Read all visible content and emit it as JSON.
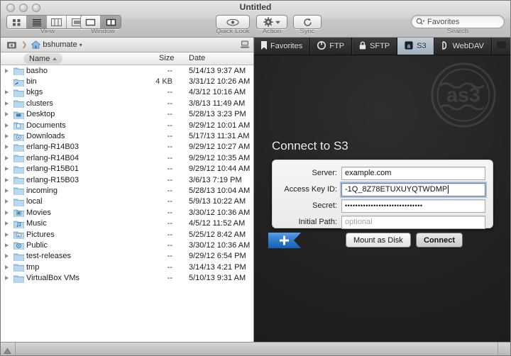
{
  "window": {
    "title": "Untitled",
    "traffic_lights": [
      "close",
      "minimize",
      "zoom"
    ]
  },
  "toolbar": {
    "view_label": "View",
    "window_label": "Window",
    "view_modes": [
      {
        "name": "icon-view",
        "selected": false
      },
      {
        "name": "list-view",
        "selected": true
      },
      {
        "name": "column-view",
        "selected": false
      },
      {
        "name": "coverflow-view",
        "selected": false
      }
    ],
    "window_modes": [
      {
        "name": "single-pane",
        "selected": false
      },
      {
        "name": "split-pane",
        "selected": true
      }
    ],
    "quick_look_label": "Quick Look",
    "action_label": "Action",
    "sync_label": "Sync",
    "search_label": "Search",
    "search_value": "Favorites",
    "search_icon": "search-icon"
  },
  "browser": {
    "path_icon": "drive-icon",
    "path_home_icon": "home-icon",
    "path_crumb": "bshumate",
    "path_menu_arrow": "▾",
    "path_right_icon": "computer-icon",
    "columns": {
      "name": "Name",
      "size": "Size",
      "date": "Date",
      "sort": "ascending"
    },
    "rows": [
      {
        "name": "basho",
        "size": "--",
        "date": "5/14/13 9:37 AM",
        "icon": "folder-icon",
        "expandable": true
      },
      {
        "name": "bin",
        "size": "4 KB",
        "date": "3/31/12 10:26 AM",
        "icon": "alias-folder-icon",
        "expandable": false
      },
      {
        "name": "bkgs",
        "size": "--",
        "date": "4/3/12 10:16 AM",
        "icon": "folder-icon",
        "expandable": true
      },
      {
        "name": "clusters",
        "size": "--",
        "date": "3/8/13 11:49 AM",
        "icon": "folder-icon",
        "expandable": true
      },
      {
        "name": "Desktop",
        "size": "--",
        "date": "5/28/13 3:23 PM",
        "icon": "desktop-folder-icon",
        "expandable": true
      },
      {
        "name": "Documents",
        "size": "--",
        "date": "9/29/12 10:01 AM",
        "icon": "documents-folder-icon",
        "expandable": true
      },
      {
        "name": "Downloads",
        "size": "--",
        "date": "5/17/13 11:31 AM",
        "icon": "downloads-folder-icon",
        "expandable": true
      },
      {
        "name": "erlang-R14B03",
        "size": "--",
        "date": "9/29/12 10:27 AM",
        "icon": "folder-icon",
        "expandable": true
      },
      {
        "name": "erlang-R14B04",
        "size": "--",
        "date": "9/29/12 10:35 AM",
        "icon": "folder-icon",
        "expandable": true
      },
      {
        "name": "erlang-R15B01",
        "size": "--",
        "date": "9/29/12 10:44 AM",
        "icon": "folder-icon",
        "expandable": true
      },
      {
        "name": "erlang-R15B03",
        "size": "--",
        "date": "3/6/13 7:19 PM",
        "icon": "folder-icon",
        "expandable": true
      },
      {
        "name": "incoming",
        "size": "--",
        "date": "5/28/13 10:04 AM",
        "icon": "folder-icon",
        "expandable": true
      },
      {
        "name": "local",
        "size": "--",
        "date": "5/9/13 10:22 AM",
        "icon": "folder-icon",
        "expandable": true
      },
      {
        "name": "Movies",
        "size": "--",
        "date": "3/30/12 10:36 AM",
        "icon": "movies-folder-icon",
        "expandable": true
      },
      {
        "name": "Music",
        "size": "--",
        "date": "4/5/12 11:52 AM",
        "icon": "music-folder-icon",
        "expandable": true
      },
      {
        "name": "Pictures",
        "size": "--",
        "date": "5/25/12 8:42 AM",
        "icon": "pictures-folder-icon",
        "expandable": true
      },
      {
        "name": "Public",
        "size": "--",
        "date": "3/30/12 10:36 AM",
        "icon": "public-folder-icon",
        "expandable": true
      },
      {
        "name": "test-releases",
        "size": "--",
        "date": "9/29/12 6:54 PM",
        "icon": "folder-icon",
        "expandable": true
      },
      {
        "name": "tmp",
        "size": "--",
        "date": "3/14/13 4:21 PM",
        "icon": "folder-icon",
        "expandable": true
      },
      {
        "name": "VirtualBox VMs",
        "size": "--",
        "date": "5/10/13 9:31 AM",
        "icon": "folder-icon",
        "expandable": true
      }
    ]
  },
  "connect": {
    "tabs": [
      {
        "label": "Favorites",
        "icon": "bookmark-icon",
        "selected": false
      },
      {
        "label": "FTP",
        "icon": "ftp-icon",
        "selected": false
      },
      {
        "label": "SFTP",
        "icon": "lock-icon",
        "selected": false
      },
      {
        "label": "S3",
        "icon": "s3-icon",
        "selected": true
      },
      {
        "label": "WebDAV",
        "icon": "webdav-icon",
        "selected": false
      },
      {
        "label": "",
        "icon": "globe-icon",
        "selected": false
      }
    ],
    "watermark": "as3",
    "title": "Connect to S3",
    "fields": [
      {
        "label": "Server:",
        "value": "example.com",
        "placeholder": "",
        "focused": false,
        "masked": false
      },
      {
        "label": "Access Key ID:",
        "value": "-1Q_8Z78ETUXUYQTWDMP",
        "placeholder": "",
        "focused": true,
        "masked": false
      },
      {
        "label": "Secret:",
        "value": "••••••••••••••••••••••••••••••",
        "placeholder": "",
        "focused": false,
        "masked": true
      },
      {
        "label": "Initial Path:",
        "value": "",
        "placeholder": "optional",
        "focused": false,
        "masked": false
      }
    ],
    "add_bookmark_label": "+",
    "mount_button": "Mount as Disk",
    "connect_button": "Connect",
    "accent_color": "#1a7ae0"
  },
  "statusbar": {
    "grip_icon": "resize-grip-icon"
  }
}
